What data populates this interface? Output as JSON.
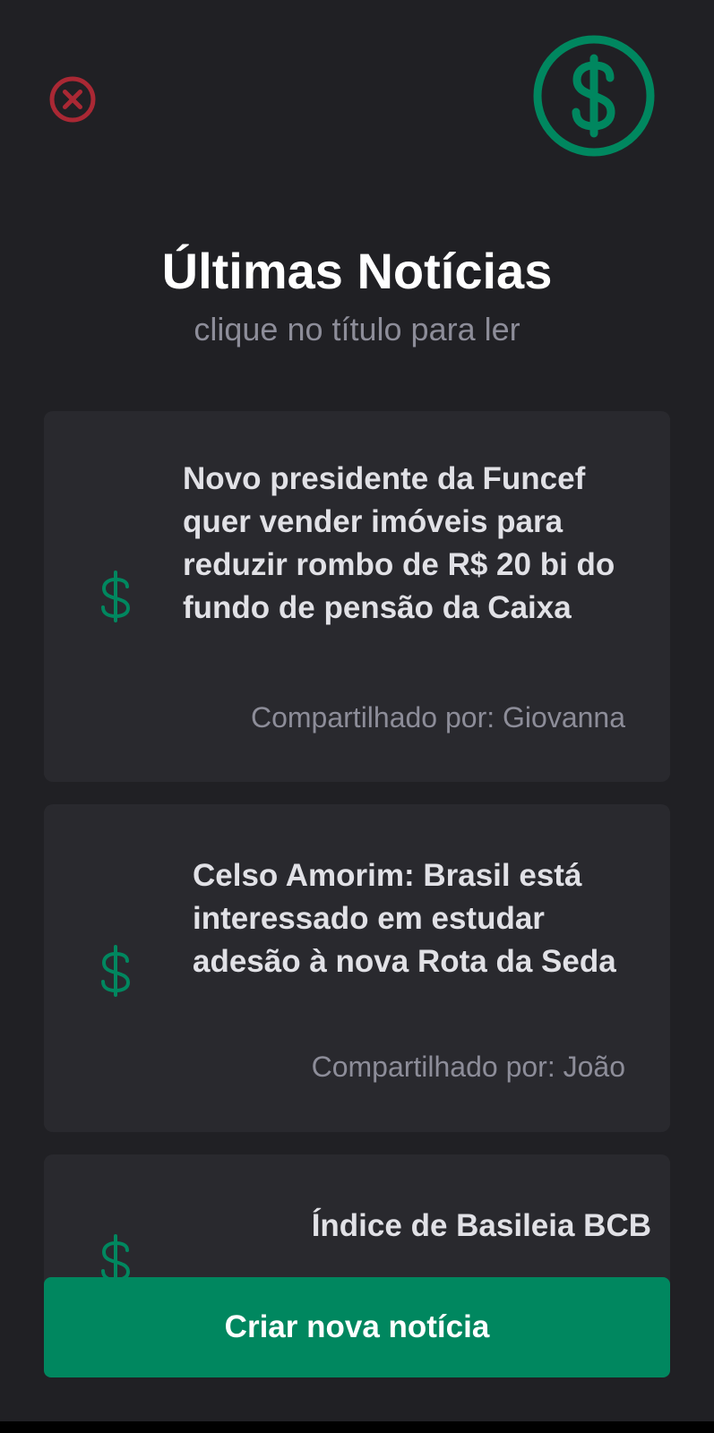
{
  "header": {
    "close_icon": "close-circle-icon",
    "logo_icon": "dollar-circle-icon",
    "title": "Últimas Notícias",
    "subtitle": "clique no título para ler"
  },
  "news": [
    {
      "icon": "dollar-sign-icon",
      "title": "Novo presidente da Funcef quer vender imóveis para reduzir rombo de R$ 20 bi do fundo de pensão da Caixa",
      "author": "Compartilhado por: Giovanna"
    },
    {
      "icon": "dollar-sign-icon",
      "title": "Celso Amorim: Brasil está interessado em estudar adesão à nova Rota da Seda",
      "author": "Compartilhado por: João"
    },
    {
      "icon": "dollar-sign-icon",
      "title": "Índice de Basileia BCB"
    }
  ],
  "footer": {
    "create_label": "Criar nova notícia"
  },
  "colors": {
    "background": "#202024",
    "card": "#29292e",
    "accent_green": "#00875f",
    "close_red": "#aa2834",
    "title_text": "#ffffff",
    "card_text": "#e1e1e6",
    "muted_text": "#8d8d99"
  }
}
